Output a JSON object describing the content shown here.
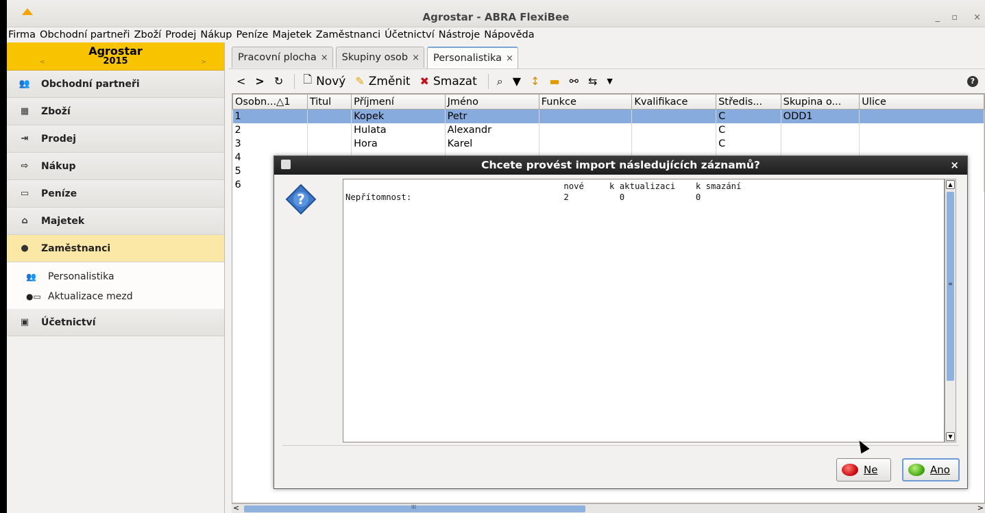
{
  "window": {
    "title": "Agrostar - ABRA FlexiBee",
    "controls": [
      "_",
      "▫",
      "×"
    ]
  },
  "menu": [
    "Firma",
    "Obchodní partneři",
    "Zboží",
    "Prodej",
    "Nákup",
    "Peníze",
    "Majetek",
    "Zaměstnanci",
    "Účetnictví",
    "Nástroje",
    "Nápověda"
  ],
  "company": {
    "name": "Agrostar",
    "year": "2015",
    "prev": "<",
    "next": ">"
  },
  "sidebar": {
    "items": [
      {
        "label": "Obchodní partneři",
        "icon": "people-icon"
      },
      {
        "label": "Zboží",
        "icon": "goods-icon"
      },
      {
        "label": "Prodej",
        "icon": "sale-icon"
      },
      {
        "label": "Nákup",
        "icon": "purchase-icon"
      },
      {
        "label": "Peníze",
        "icon": "money-icon"
      },
      {
        "label": "Majetek",
        "icon": "property-icon"
      },
      {
        "label": "Zaměstnanci",
        "icon": "person-icon"
      }
    ],
    "sub_items": [
      {
        "label": "Personalistika",
        "icon": "people-icon"
      },
      {
        "label": "Aktualizace mezd",
        "icon": "payroll-icon"
      }
    ],
    "last_item": {
      "label": "Účetnictví",
      "icon": "accounting-icon"
    }
  },
  "tabs": [
    {
      "label": "Pracovní plocha",
      "close": "×"
    },
    {
      "label": "Skupiny osob",
      "close": "×"
    },
    {
      "label": "Personalistika",
      "close": "×"
    }
  ],
  "toolbar": {
    "back": "<",
    "forward": ">",
    "refresh": "↻",
    "new": "Nový",
    "edit": "Změnit",
    "delete": "Smazat",
    "help": "?"
  },
  "table": {
    "columns": [
      "Osobn...△1",
      "Titul",
      "Příjmení",
      "Jméno",
      "Funkce",
      "Kvalifikace",
      "Středis...",
      "Skupina o...",
      "Ulice"
    ],
    "rows": [
      [
        "1",
        "",
        "Kopek",
        "Petr",
        "",
        "",
        "C",
        "ODD1",
        ""
      ],
      [
        "2",
        "",
        "Hulata",
        "Alexandr",
        "",
        "",
        "C",
        "",
        ""
      ],
      [
        "3",
        "",
        "Hora",
        "Karel",
        "",
        "",
        "C",
        "",
        ""
      ],
      [
        "4",
        "",
        "",
        "",
        "",
        "",
        "",
        "",
        ""
      ],
      [
        "5",
        "",
        "",
        "",
        "",
        "",
        "",
        "",
        ""
      ],
      [
        "6",
        "",
        "",
        "",
        "",
        "",
        "",
        "",
        ""
      ]
    ]
  },
  "dialog": {
    "title": "Chcete provést import následujících záznamů?",
    "close": "×",
    "content": "                                           nové     k aktualizaci    k smazání\nNepřítomnost:                              2          0              0",
    "btn_no": "Ne",
    "btn_yes": "Ano"
  }
}
